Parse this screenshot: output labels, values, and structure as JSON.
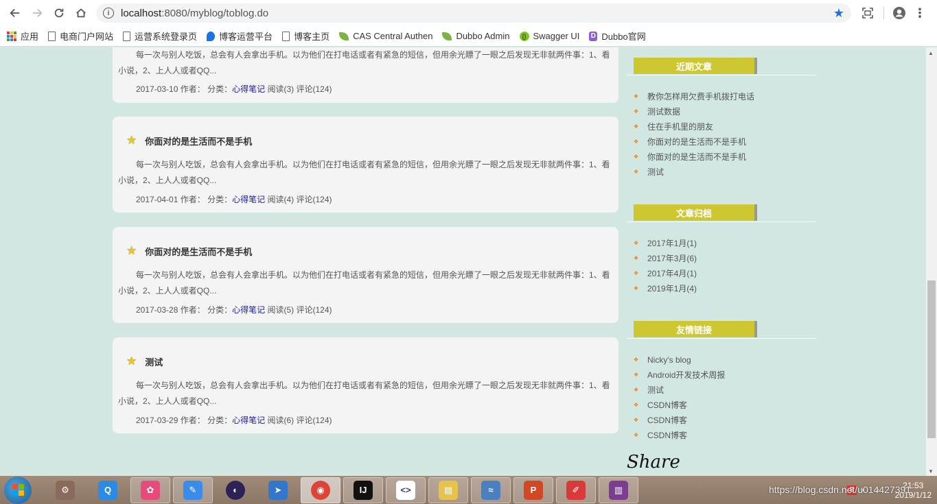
{
  "browser": {
    "url_host": "localhost",
    "url_rest": ":8080/myblog/toblog.do"
  },
  "bookmarks": [
    {
      "label": "应用",
      "icon": "apps-grid-icon"
    },
    {
      "label": "电商门户网站",
      "icon": "page-icon"
    },
    {
      "label": "运营系统登录页",
      "icon": "page-icon"
    },
    {
      "label": "博客运营平台",
      "icon": "blue-bird-icon"
    },
    {
      "label": "博客主页",
      "icon": "page-icon"
    },
    {
      "label": "CAS Central Authen",
      "icon": "leaf-icon"
    },
    {
      "label": "Dubbo Admin",
      "icon": "leaf-icon"
    },
    {
      "label": "Swagger UI",
      "icon": "swagger-icon"
    },
    {
      "label": "Dubbo官网",
      "icon": "dubbo-icon"
    }
  ],
  "posts": [
    {
      "title": "",
      "body": "每一次与别人吃饭，总会有人会拿出手机。以为他们在打电话或者有紧急的短信，但用余光瞟了一眼之后发现无非就两件事：1、看小说，2、上人人或者QQ...",
      "date": "2017-03-10",
      "author_label": "作者：",
      "category_label": "分类：",
      "category": "心得笔记",
      "reads": "阅读(3)",
      "comments": "评论(124)"
    },
    {
      "title": "你面对的是生活而不是手机",
      "body": "每一次与别人吃饭，总会有人会拿出手机。以为他们在打电话或者有紧急的短信，但用余光瞟了一眼之后发现无非就两件事：1、看小说，2、上人人或者QQ...",
      "date": "2017-04-01",
      "author_label": "作者：",
      "category_label": "分类：",
      "category": "心得笔记",
      "reads": "阅读(4)",
      "comments": "评论(124)"
    },
    {
      "title": "你面对的是生活而不是手机",
      "body": "每一次与别人吃饭，总会有人会拿出手机。以为他们在打电话或者有紧急的短信，但用余光瞟了一眼之后发现无非就两件事：1、看小说，2、上人人或者QQ...",
      "date": "2017-03-28",
      "author_label": "作者：",
      "category_label": "分类：",
      "category": "心得笔记",
      "reads": "阅读(5)",
      "comments": "评论(124)"
    },
    {
      "title": "测试",
      "body": "每一次与别人吃饭，总会有人会拿出手机。以为他们在打电话或者有紧急的短信，但用余光瞟了一眼之后发现无非就两件事：1、看小说，2、上人人或者QQ...",
      "date": "2017-03-29",
      "author_label": "作者：",
      "category_label": "分类：",
      "category": "心得笔记",
      "reads": "阅读(6)",
      "comments": "评论(124)"
    }
  ],
  "sidebar": {
    "recent": {
      "heading": "近期文章",
      "items": [
        "教你怎样用欠费手机拨打电话",
        "测试数据",
        "住在手机里的朋友",
        "你面对的是生活而不是手机",
        "你面对的是生活而不是手机",
        "测试"
      ]
    },
    "archive": {
      "heading": "文章归档",
      "items": [
        "2017年1月(1)",
        "2017年3月(6)",
        "2017年4月(1)",
        "2019年1月(4)"
      ]
    },
    "links": {
      "heading": "友情链接",
      "items": [
        "Nicky's blog",
        "Android开发技术周报",
        "测试",
        "CSDN博客",
        "CSDN博客",
        "CSDN博客"
      ]
    }
  },
  "share_label": "Share",
  "taskbar": {
    "apps": [
      {
        "name": "database-tool-icon",
        "color": "#8a6a5a",
        "glyph": "⚙"
      },
      {
        "name": "qq-browser-icon",
        "color": "#2b8ae2",
        "glyph": "Q"
      },
      {
        "name": "picasa-icon",
        "color": "#e84a7b",
        "glyph": "✿"
      },
      {
        "name": "notes-app-icon",
        "color": "#3a8bea",
        "glyph": "✎"
      },
      {
        "name": "eclipse-icon",
        "color": "#2c2255",
        "glyph": "◐"
      },
      {
        "name": "send-app-icon",
        "color": "#3377cc",
        "glyph": "➤"
      },
      {
        "name": "chrome-icon",
        "color": "#db4437",
        "glyph": "◉"
      },
      {
        "name": "intellij-icon",
        "color": "#111111",
        "glyph": "IJ"
      },
      {
        "name": "code-editor-icon",
        "color": "#ffffff",
        "glyph": "<>"
      },
      {
        "name": "file-explorer-icon",
        "color": "#e8c34a",
        "glyph": "▤"
      },
      {
        "name": "dolphin-icon",
        "color": "#4a7fc0",
        "glyph": "≈"
      },
      {
        "name": "powerpoint-icon",
        "color": "#d24726",
        "glyph": "P"
      },
      {
        "name": "editor-pen-icon",
        "color": "#d83a3a",
        "glyph": "✐"
      },
      {
        "name": "winrar-icon",
        "color": "#7b3e8e",
        "glyph": "▥"
      }
    ],
    "time": "21:53",
    "date": "2019/1/12",
    "watermark": "https://blog.csdn.net/u014427391"
  }
}
